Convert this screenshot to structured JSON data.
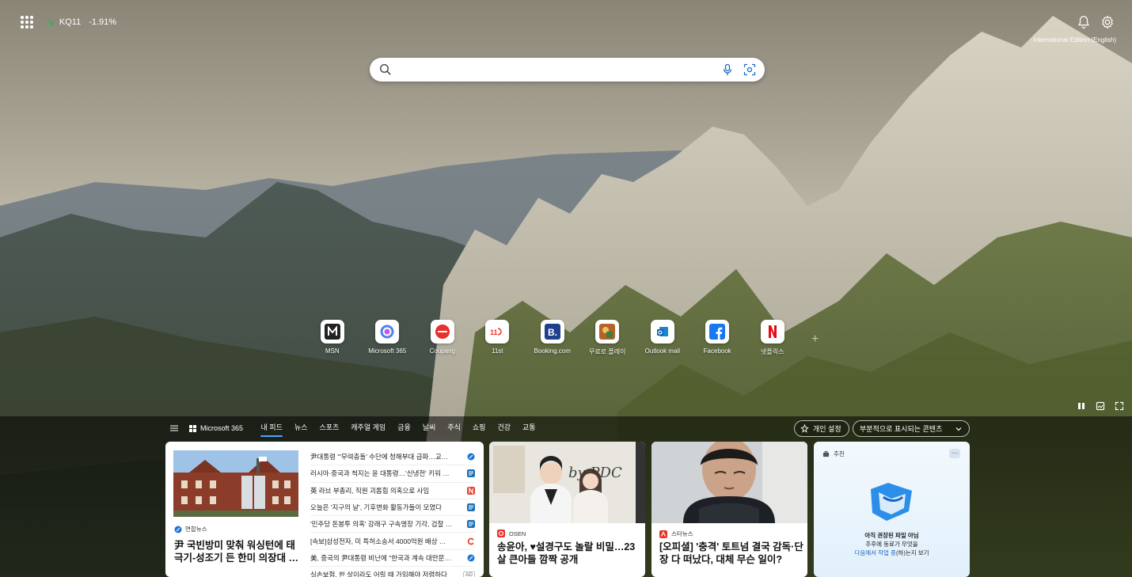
{
  "topbar": {
    "stock_symbol": "KQ11",
    "stock_change": "-1.91%",
    "edition": "International Edition (English)"
  },
  "search": {
    "placeholder": ""
  },
  "quicklinks": [
    {
      "label": "MSN",
      "icon": "msn-icon"
    },
    {
      "label": "Microsoft 365",
      "icon": "microsoft365-icon"
    },
    {
      "label": "Coupang",
      "icon": "coupang-icon"
    },
    {
      "label": "11st",
      "icon": "11st-icon"
    },
    {
      "label": "Booking.com",
      "icon": "booking-icon"
    },
    {
      "label": "무료로 플레이",
      "icon": "game-icon"
    },
    {
      "label": "Outlook mail",
      "icon": "outlook-icon"
    },
    {
      "label": "Facebook",
      "icon": "facebook-icon"
    },
    {
      "label": "넷플릭스",
      "icon": "netflix-icon"
    }
  ],
  "feed_nav": {
    "m365": "Microsoft 365",
    "tabs": [
      "내 피드",
      "뉴스",
      "스포츠",
      "캐주얼 게임",
      "금융",
      "날씨",
      "주식",
      "쇼핑",
      "건강",
      "교통"
    ],
    "personal": "개인 설정",
    "content_filter": "부분적으로 표시되는 콘텐츠"
  },
  "main_card": {
    "source": "연합뉴스",
    "headline": "尹 국빈방미 맞춰 워싱턴에 태극기-성조기 든 한미 의장대 …",
    "headlines": [
      {
        "text": "尹대통령 \"'무력충돌' 수단에 청해부대 급파…교…",
        "icon": "yonhap-icon",
        "color": "#1e73d8"
      },
      {
        "text": "러시아·중국과 척지는 윤 대통령…'신냉전' 키워 …",
        "icon": "news-icon",
        "color": "#1d6fb8"
      },
      {
        "text": "英 라브 부총리, 직원 괴롭힘 의혹으로 사임",
        "icon": "n-icon",
        "color": "#e8412a"
      },
      {
        "text": "오늘은 '지구의 날', 기후변화 활동가들이 모였다",
        "icon": "news-icon",
        "color": "#1d6fb8"
      },
      {
        "text": "'민주당 돈봉투 의혹' 강래구 구속영장 기각, 검찰 …",
        "icon": "news-icon",
        "color": "#1d6fb8"
      },
      {
        "text": "[속보]삼성전자, 미 특허소송서 4000억원 배상 …",
        "icon": "c-icon",
        "color": "#e8412a"
      },
      {
        "text": "美, 중국의 尹대통령 비난에 \"한국과 계속 대만문…",
        "icon": "yonhap-icon",
        "color": "#1e73d8"
      },
      {
        "text": "실손보험, 한 살이라도 어릴 때 가입해야 저렴하다",
        "ad": "AD"
      }
    ]
  },
  "card2": {
    "source": "OSEN",
    "headline": "송윤아, ♥설경구도 놀랄 비밀…23살 큰아들 깜짝 공개",
    "photo_text": "by PDC"
  },
  "card3": {
    "source": "스타뉴스",
    "headline": "[오피셜] '충격' 토트넘 결국 감독·단장 다 떠났다, 대체 무슨 일이?"
  },
  "rec_card": {
    "header": "추천",
    "title": "아직 권장된 파일 아님",
    "line2": "추후에 동료가 무엇을",
    "link": "다음에서 작업 중",
    "line3_suffix": "(하)는지 보기"
  }
}
